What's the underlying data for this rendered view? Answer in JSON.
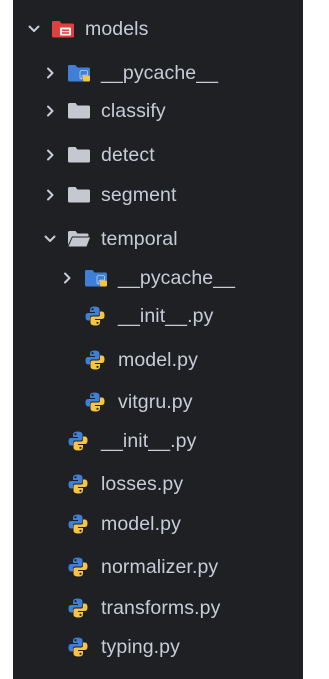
{
  "explorer": {
    "root": {
      "label": "models",
      "icon": "folder-open-models-icon",
      "expanded": true
    },
    "items": [
      {
        "label": "__pycache__",
        "icon": "folder-python-icon",
        "expanded": false
      },
      {
        "label": "classify",
        "icon": "folder-icon",
        "expanded": false
      },
      {
        "label": "detect",
        "icon": "folder-icon",
        "expanded": false
      },
      {
        "label": "segment",
        "icon": "folder-icon",
        "expanded": false
      },
      {
        "label": "temporal",
        "icon": "folder-open-icon",
        "expanded": true
      },
      {
        "label": "__pycache__",
        "icon": "folder-python-icon",
        "expanded": false
      },
      {
        "label": "__init__.py",
        "icon": "python-file-icon"
      },
      {
        "label": "model.py",
        "icon": "python-file-icon"
      },
      {
        "label": "vitgru.py",
        "icon": "python-file-icon"
      },
      {
        "label": "__init__.py",
        "icon": "python-file-icon"
      },
      {
        "label": "losses.py",
        "icon": "python-file-icon"
      },
      {
        "label": "model.py",
        "icon": "python-file-icon"
      },
      {
        "label": "normalizer.py",
        "icon": "python-file-icon"
      },
      {
        "label": "transforms.py",
        "icon": "python-file-icon"
      },
      {
        "label": "typing.py",
        "icon": "python-file-icon"
      }
    ]
  },
  "colors": {
    "background": "#1f2024",
    "text": "#c7ccd6",
    "folder": "#c5c8ce",
    "folder_red": "#e0413e",
    "python_blue": "#3f7fd6",
    "python_yellow": "#f7c543"
  }
}
